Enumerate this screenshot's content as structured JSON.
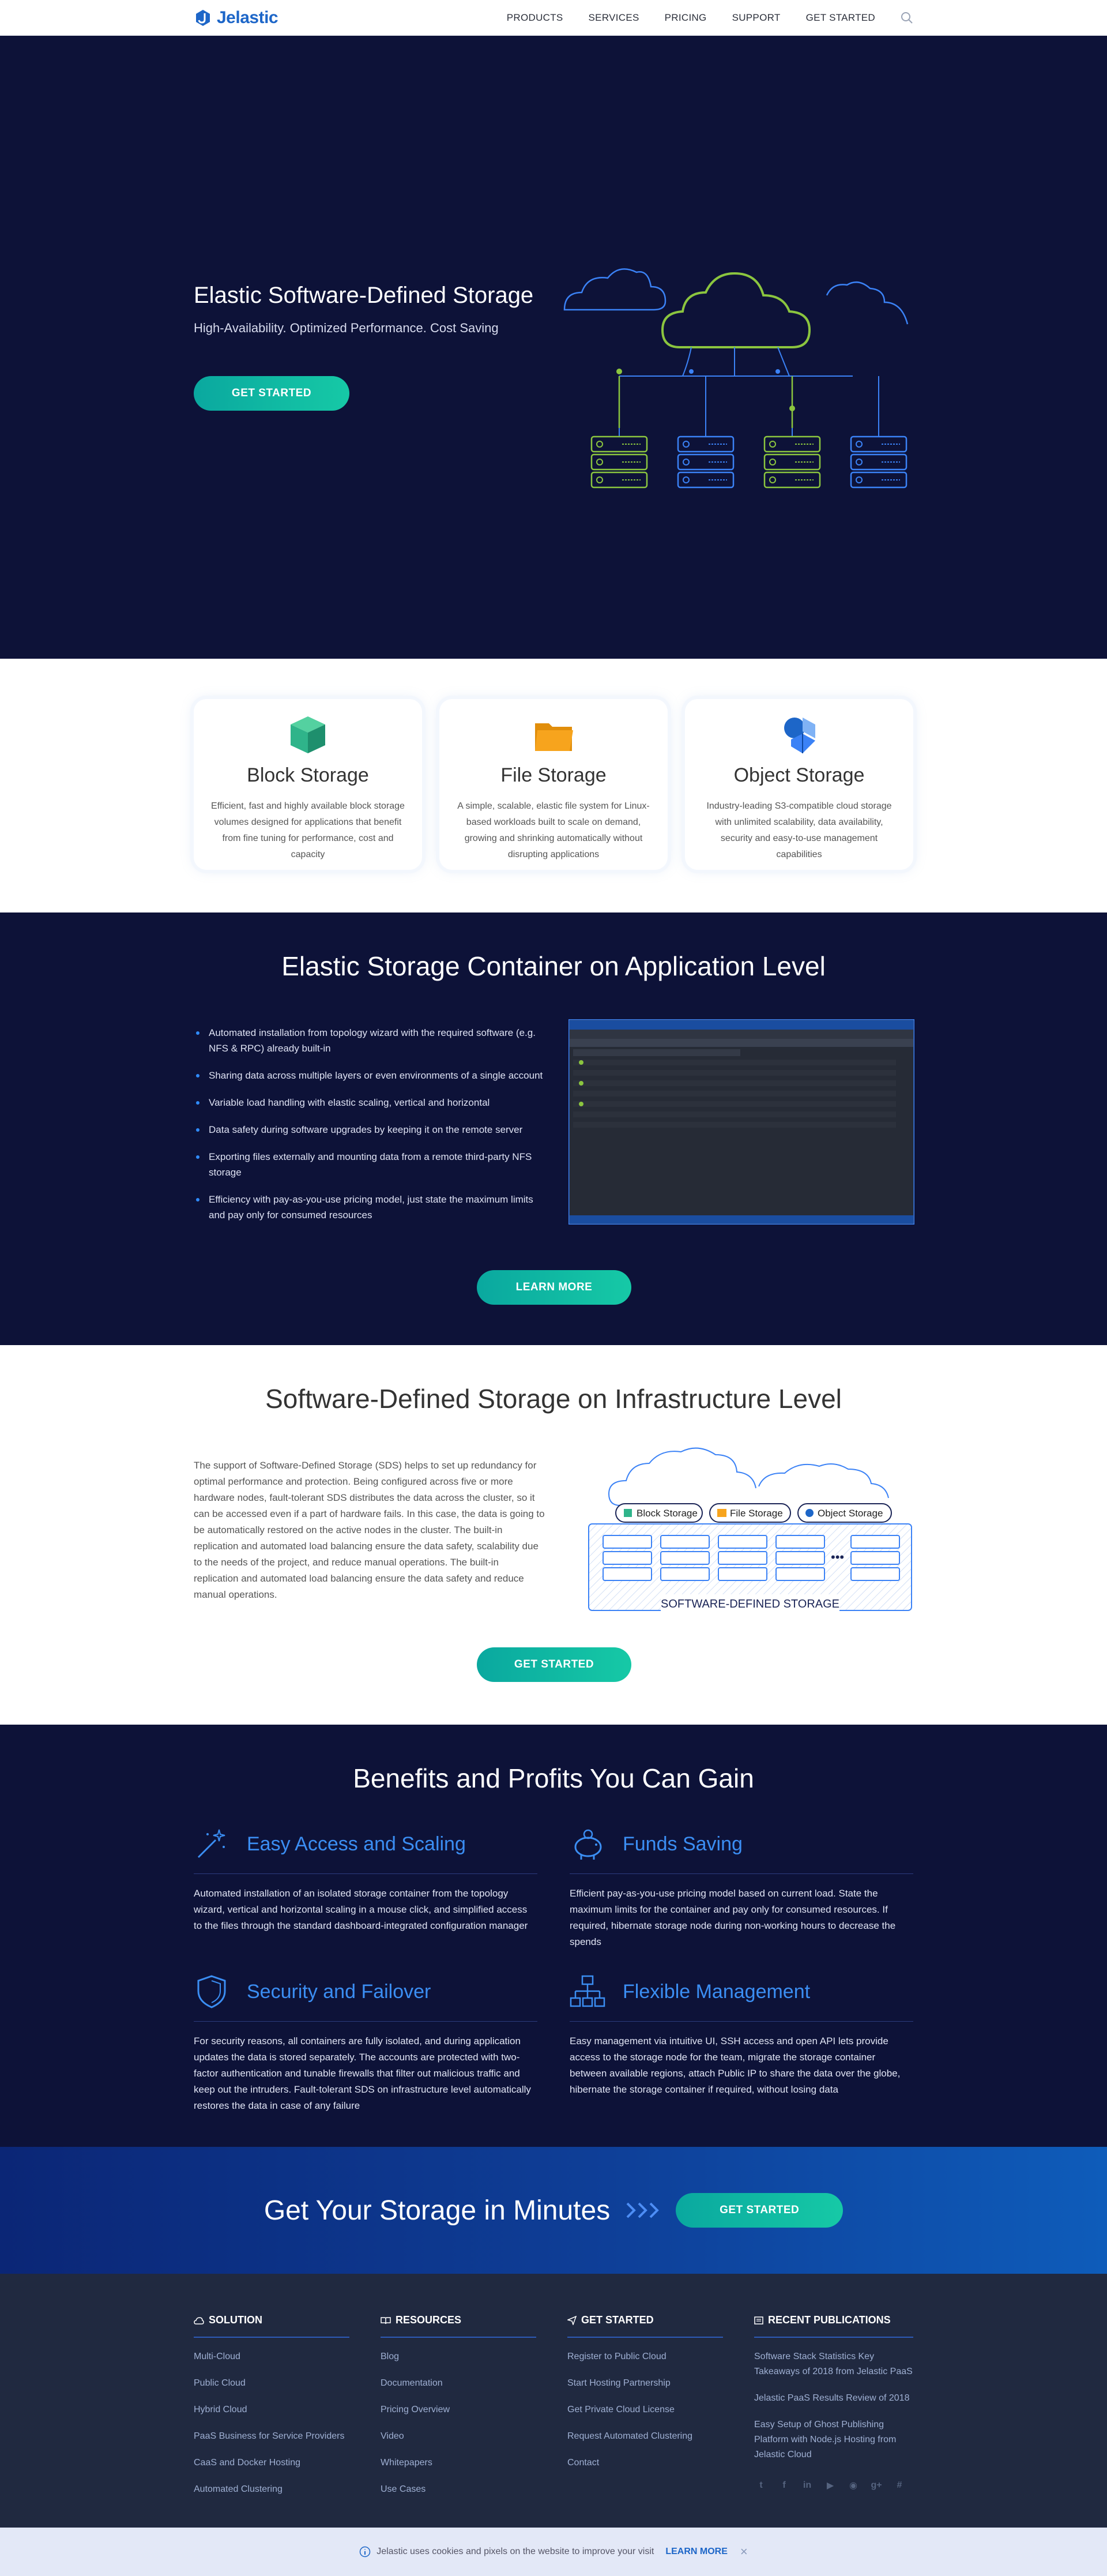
{
  "nav": {
    "logo": "Jelastic",
    "items": [
      {
        "label": "PRODUCTS"
      },
      {
        "label": "SERVICES"
      },
      {
        "label": "PRICING"
      },
      {
        "label": "SUPPORT"
      },
      {
        "label": "GET STARTED"
      }
    ]
  },
  "hero": {
    "title": "Elastic Software-Defined Storage",
    "subtitle": "High-Availability. Optimized Performance. Cost Saving",
    "button": "GET STARTED"
  },
  "storage_types": [
    {
      "title": "Block Storage",
      "text": "Efficient, fast and highly available block storage volumes designed for applications that benefit from fine tuning for performance, cost and capacity",
      "icon": "cube-icon",
      "color": "#2fb48a"
    },
    {
      "title": "File Storage",
      "text": "A simple, scalable, elastic file system for Linux-based workloads built to scale on demand, growing and shrinking automatically without disrupting applications",
      "icon": "folder-icon",
      "color": "#f7a41d"
    },
    {
      "title": "Object Storage",
      "text": "Industry-leading S3-compatible cloud storage with unlimited scalability, data availability, security and easy-to-use management capabilities",
      "icon": "shapes-icon",
      "color": "#1d66c8"
    }
  ],
  "app_level": {
    "title": "Elastic Storage Container on Application Level",
    "bullets": [
      "Automated installation from topology wizard with the required software (e.g. NFS & RPC) already built-in",
      "Sharing data across multiple layers or even environments of a single account",
      "Variable load handling with elastic scaling, vertical and horizontal",
      "Data safety during software upgrades by keeping it on the remote server",
      "Exporting files externally and mounting data from a remote third-party NFS storage",
      "Efficiency with pay-as-you-use pricing model, just state the maximum limits and pay only for consumed resources"
    ],
    "button": "LEARN MORE"
  },
  "infra_level": {
    "title": "Software-Defined Storage on Infrastructure Level",
    "text": "The support of Software-Defined Storage (SDS) helps to set up redundancy for optimal performance and protection. Being configured across five or more hardware nodes, fault-tolerant SDS distributes the data across the cluster, so it can be accessed even if a part of hardware fails. In this case, the data is going to be automatically restored on the active nodes in the cluster. The built-in replication and automated load balancing ensure the data safety, scalability due to the needs of the project, and reduce manual operations. The built-in replication and automated load balancing ensure the data safety and reduce manual operations.",
    "diagram_labels": [
      "Block Storage",
      "File Storage",
      "Object Storage"
    ],
    "diagram_caption": "SOFTWARE-DEFINED STORAGE",
    "button": "GET STARTED"
  },
  "benefits": {
    "title": "Benefits and Profits You Can Gain",
    "items": [
      {
        "title": "Easy Access and Scaling",
        "icon": "magic-wand-icon",
        "text": "Automated installation of an isolated storage container from the topology wizard, vertical and horizontal scaling in a mouse click, and simplified access to the files through the standard dashboard-integrated configuration manager"
      },
      {
        "title": "Funds Saving",
        "icon": "piggy-bank-icon",
        "text": "Efficient pay-as-you-use pricing model based on current load. State the maximum limits for the container and pay only for consumed resources. If required, hibernate storage node during non-working hours to decrease the spends"
      },
      {
        "title": "Security and Failover",
        "icon": "shield-icon",
        "text": "For security reasons, all containers are fully isolated, and during application updates the data is stored separately. The accounts are protected with two-factor authentication and tunable firewalls that filter out malicious traffic and keep out the intruders. Fault-tolerant SDS on infrastructure level automatically restores the data in case of any failure"
      },
      {
        "title": "Flexible Management",
        "icon": "hierarchy-icon",
        "text": "Easy management via intuitive UI, SSH access and open API lets provide access to the storage node for the team, migrate the storage container between available regions, attach Public IP to share the data over the globe, hibernate the storage container if required, without losing data"
      }
    ]
  },
  "cta": {
    "title": "Get Your Storage in Minutes",
    "button": "GET STARTED"
  },
  "footer": {
    "columns": [
      {
        "title": "SOLUTION",
        "links": [
          "Multi-Cloud",
          "Public Cloud",
          "Hybrid Cloud",
          "PaaS Business for Service Providers",
          "CaaS and Docker Hosting",
          "Automated Clustering"
        ]
      },
      {
        "title": "RESOURCES",
        "links": [
          "Blog",
          "Documentation",
          "Pricing Overview",
          "Video",
          "Whitepapers",
          "Use Cases"
        ]
      },
      {
        "title": "GET STARTED",
        "links": [
          "Register to Public Cloud",
          "Start Hosting Partnership",
          "Get Private Cloud License",
          "Request Automated Clustering",
          "Contact"
        ]
      },
      {
        "title": "RECENT PUBLICATIONS",
        "links": [
          "Software Stack Statistics Key Takeaways of 2018 from Jelastic PaaS",
          "Jelastic PaaS Results Review of 2018",
          "Easy Setup of Ghost Publishing Platform with Node.js Hosting from Jelastic Cloud"
        ]
      }
    ],
    "social": [
      "twitter-icon",
      "facebook-icon",
      "linkedin-icon",
      "youtube-icon",
      "rss-icon",
      "google-plus-icon",
      "slack-icon"
    ]
  },
  "cookie": {
    "text": "Jelastic uses cookies and pixels on the website to improve your visit",
    "link": "LEARN MORE"
  },
  "colors": {
    "navy": "#0d1238",
    "accent_blue": "#1d66c8",
    "teal": "#16c9a6",
    "green": "#8bc53f"
  }
}
